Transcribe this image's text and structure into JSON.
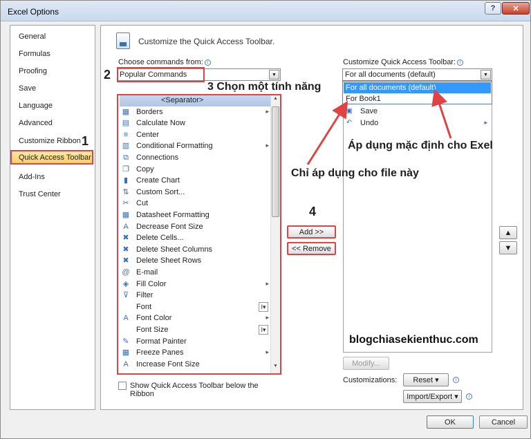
{
  "window": {
    "title": "Excel Options",
    "help_label": "?",
    "close_label": "✕"
  },
  "nav": {
    "items": [
      {
        "label": "General"
      },
      {
        "label": "Formulas"
      },
      {
        "label": "Proofing"
      },
      {
        "label": "Save"
      },
      {
        "label": "Language"
      },
      {
        "label": "Advanced"
      },
      {
        "label": "Customize Ribbon"
      },
      {
        "label": "Quick Access Toolbar"
      },
      {
        "label": "Add-Ins"
      },
      {
        "label": "Trust Center"
      }
    ],
    "selected": "Quick Access Toolbar"
  },
  "header": {
    "title": "Customize the Quick Access Toolbar."
  },
  "choose": {
    "label": "Choose commands from:",
    "value": "Popular Commands"
  },
  "customize": {
    "label": "Customize Quick Access Toolbar:",
    "value": "For all documents (default)",
    "options": [
      "For all documents (default)",
      "For Book1"
    ],
    "selected_option": "For all documents (default)"
  },
  "commands": [
    {
      "icon": "",
      "label": "<Separator>",
      "sub": ""
    },
    {
      "icon": "borders-icon",
      "label": "Borders",
      "sub": "▸"
    },
    {
      "icon": "calculate-icon",
      "label": "Calculate Now",
      "sub": ""
    },
    {
      "icon": "center-icon",
      "label": "Center",
      "sub": ""
    },
    {
      "icon": "conditional-formatting-icon",
      "label": "Conditional Formatting",
      "sub": "▸"
    },
    {
      "icon": "connections-icon",
      "label": "Connections",
      "sub": ""
    },
    {
      "icon": "copy-icon",
      "label": "Copy",
      "sub": ""
    },
    {
      "icon": "chart-icon",
      "label": "Create Chart",
      "sub": ""
    },
    {
      "icon": "sort-icon",
      "label": "Custom Sort...",
      "sub": ""
    },
    {
      "icon": "cut-icon",
      "label": "Cut",
      "sub": ""
    },
    {
      "icon": "datasheet-icon",
      "label": "Datasheet Formatting",
      "sub": ""
    },
    {
      "icon": "decrease-font-icon",
      "label": "Decrease Font Size",
      "sub": ""
    },
    {
      "icon": "delete-cells-icon",
      "label": "Delete Cells...",
      "sub": ""
    },
    {
      "icon": "delete-columns-icon",
      "label": "Delete Sheet Columns",
      "sub": ""
    },
    {
      "icon": "delete-rows-icon",
      "label": "Delete Sheet Rows",
      "sub": ""
    },
    {
      "icon": "email-icon",
      "label": "E-mail",
      "sub": ""
    },
    {
      "icon": "fill-color-icon",
      "label": "Fill Color",
      "sub": "▸"
    },
    {
      "icon": "filter-icon",
      "label": "Filter",
      "sub": ""
    },
    {
      "icon": "",
      "label": "Font",
      "sub": "I▾"
    },
    {
      "icon": "font-color-icon",
      "label": "Font Color",
      "sub": "▸"
    },
    {
      "icon": "",
      "label": "Font Size",
      "sub": "I▾"
    },
    {
      "icon": "format-painter-icon",
      "label": "Format Painter",
      "sub": ""
    },
    {
      "icon": "freeze-panes-icon",
      "label": "Freeze Panes",
      "sub": "▸"
    },
    {
      "icon": "increase-font-icon",
      "label": "Increase Font Size",
      "sub": ""
    }
  ],
  "qat_items": [
    {
      "icon": "save-icon",
      "label": "Save",
      "sub": ""
    },
    {
      "icon": "undo-icon",
      "label": "Undo",
      "sub": "▸"
    }
  ],
  "buttons": {
    "add": "Add >>",
    "remove": "<< Remove",
    "modify": "Modify...",
    "reset": "Reset ▾",
    "import_export": "Import/Export ▾",
    "ok": "OK",
    "cancel": "Cancel",
    "move_up": "▲",
    "move_down": "▼"
  },
  "customizations_label": "Customizations:",
  "show_below": "Show Quick Access Toolbar below the Ribbon",
  "annotations": {
    "n1": "1",
    "n2": "2",
    "n3": "3 Chọn một tính năng",
    "n4": "4",
    "default_text": "Áp dụng mặc định cho Exel",
    "this_file_text": "Chỉ áp dụng cho file này",
    "blog": "blogchiasekienthuc.com"
  },
  "colors": {
    "annotation_red": "#e04343",
    "selection_blue": "#3399ff",
    "nav_selected": "#f9cf63"
  }
}
